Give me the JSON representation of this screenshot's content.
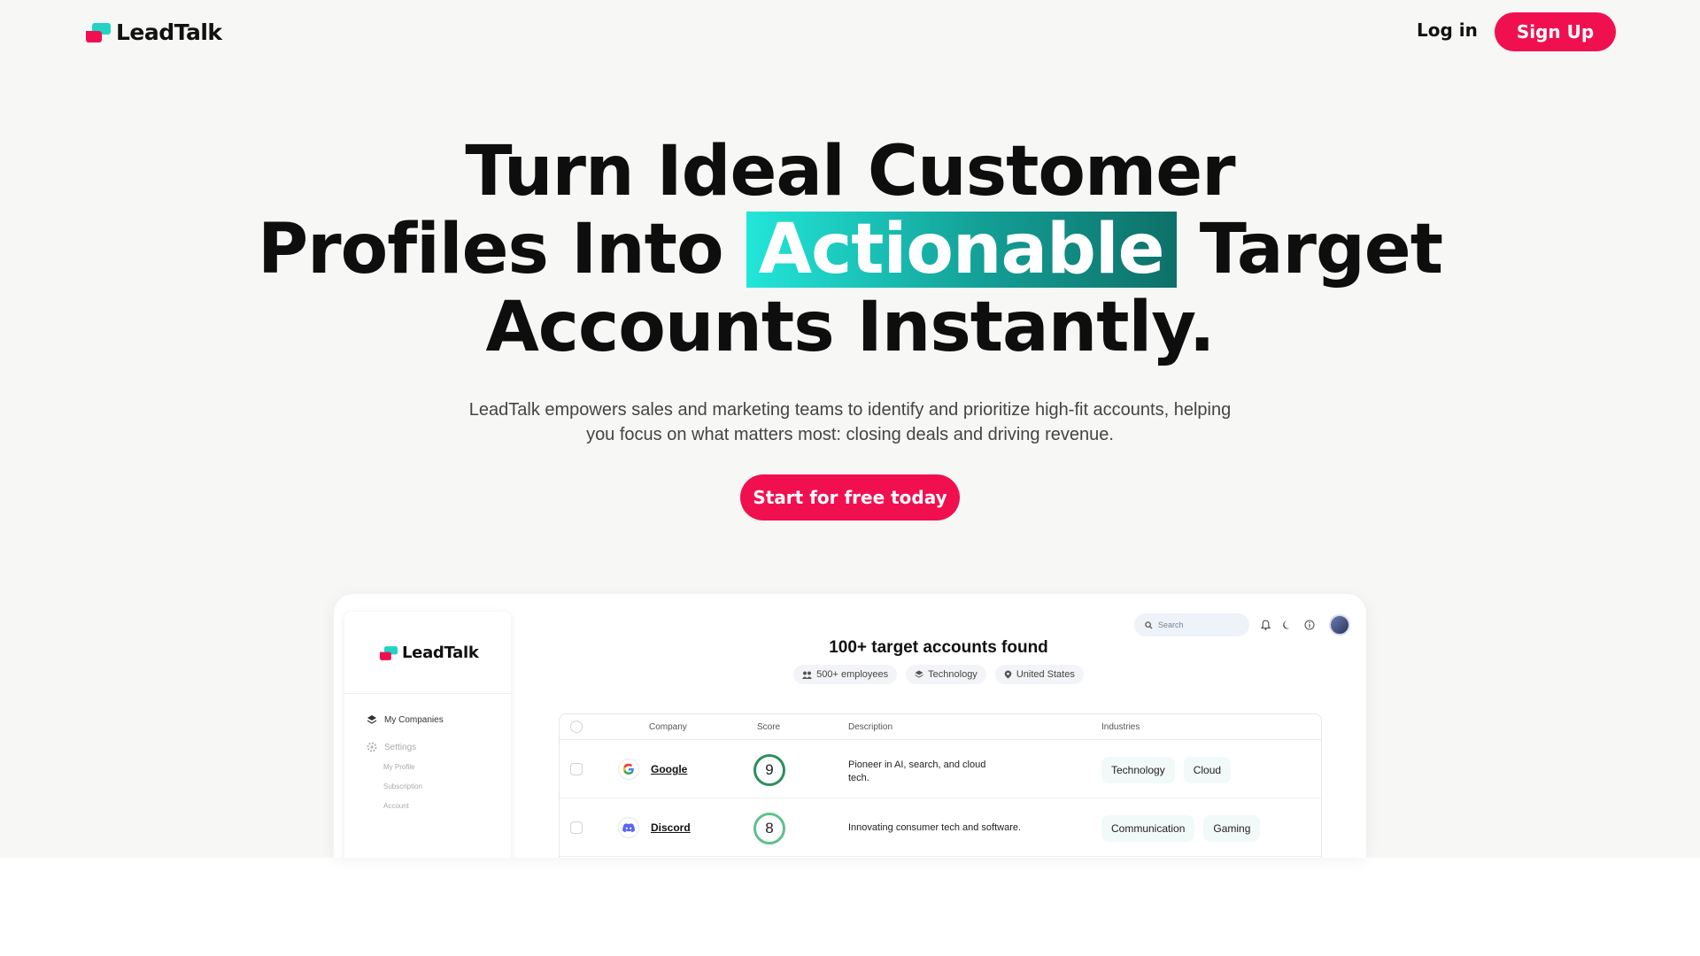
{
  "brand": {
    "name": "LeadTalk",
    "accent": "#f0104f",
    "highlight_start": "#22e6d9",
    "highlight_end": "#0e7068"
  },
  "header": {
    "login_label": "Log in",
    "signup_label": "Sign Up"
  },
  "hero": {
    "headline_line1": "Turn Ideal Customer",
    "headline_line2_pre": "Profiles Into",
    "headline_highlight": "Actionable",
    "headline_line2_post": "Target",
    "headline_line3": "Accounts Instantly.",
    "subtitle_line1": "LeadTalk empowers sales and marketing teams to identify and prioritize high-fit accounts, helping",
    "subtitle_line2": "you focus on what matters most: closing deals and driving revenue.",
    "cta_label": "Start for free today"
  },
  "preview": {
    "sidebar": {
      "logo": "LeadTalk",
      "my_companies": "My Companies",
      "settings": "Settings",
      "sub_items": [
        "My Profile",
        "Subscription",
        "Account"
      ]
    },
    "search_placeholder": "Search",
    "results_title": "100+ target accounts found",
    "filters": [
      "500+ employees",
      "Technology",
      "United States"
    ],
    "columns": [
      "Company",
      "Score",
      "Description",
      "Industries"
    ],
    "rows": [
      {
        "company": "Google",
        "score": "9",
        "description": "Pioneer in AI, search, and cloud tech.",
        "industries": [
          "Technology",
          "Cloud"
        ]
      },
      {
        "company": "Discord",
        "score": "8",
        "description": "Innovating consumer tech and software.",
        "industries": [
          "Communication",
          "Gaming"
        ]
      }
    ]
  }
}
